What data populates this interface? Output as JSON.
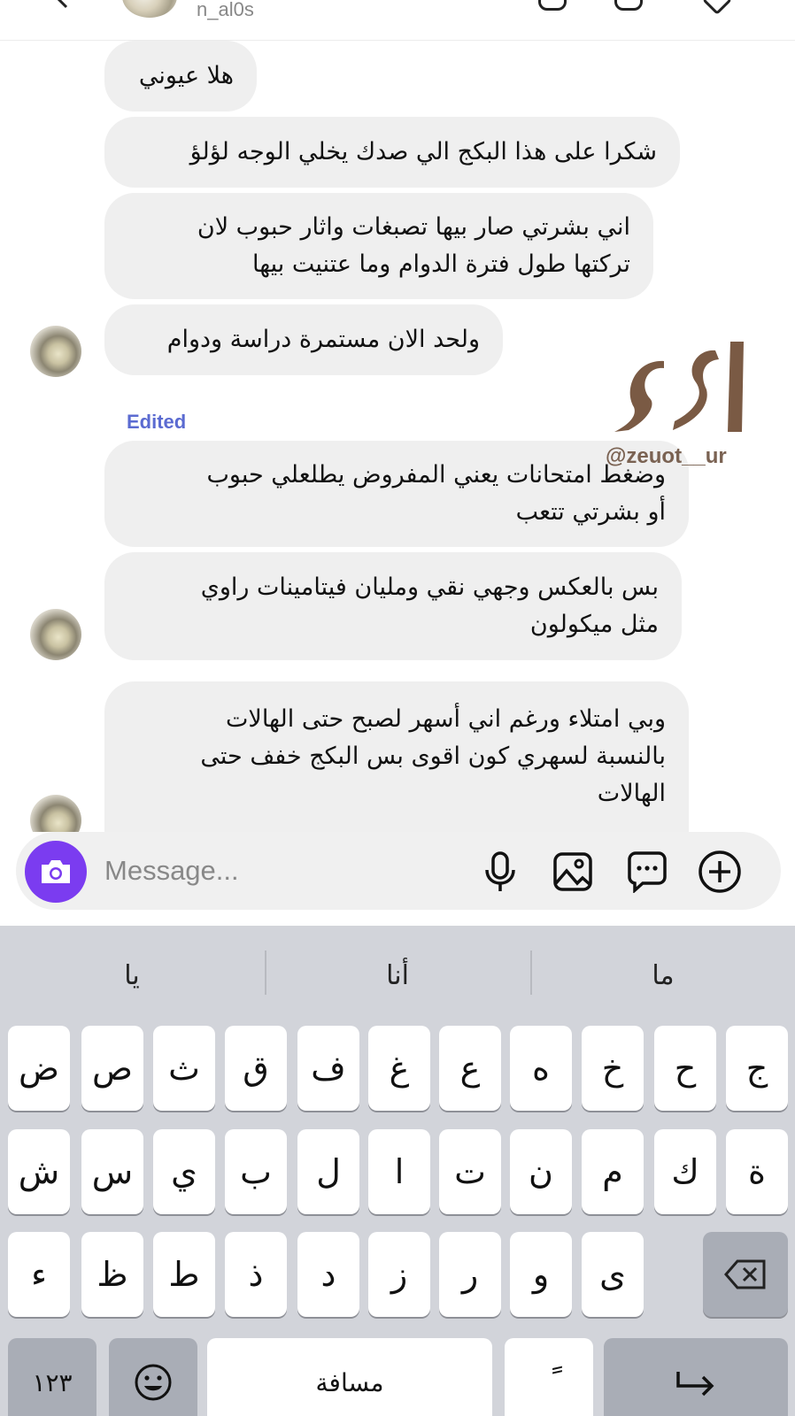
{
  "header": {
    "username": "n_al0s"
  },
  "messages": [
    {
      "lines": [
        "هلا عيوني"
      ]
    },
    {
      "lines": [
        "شكرا على هذا البكج الي صدك يخلي الوجه لؤلؤ"
      ]
    },
    {
      "lines": [
        "اني بشرتي صار بيها تصبغات واثار حبوب لان",
        "تركتها طول فترة الدوام وما عتنيت بيها"
      ]
    },
    {
      "lines": [
        "ولحد الان مستمرة دراسة ودوام"
      ]
    },
    {
      "lines": [
        "وضغط امتحانات يعني المفروض يطلعلي حبوب",
        "أو بشرتي تتعب"
      ]
    },
    {
      "lines": [
        "بس بالعكس وجهي نقي ومليان فيتامينات راوي",
        "مثل ميكولون"
      ]
    },
    {
      "lines": [
        "وبي امتلاء ورغم اني أسهر لصبح حتى الهالات",
        "بالنسبة لسهري كون اقوى بس البكج خفف حتى",
        "الهالات"
      ]
    }
  ],
  "edited_label": "Edited",
  "watermark": {
    "text": "@zeuot__ur"
  },
  "composer": {
    "placeholder": "Message...",
    "icons": [
      "camera-icon",
      "microphone-icon",
      "gallery-icon",
      "sticker-icon",
      "plus-icon"
    ],
    "camera_color": "#7b3cf0"
  },
  "keyboard": {
    "suggestions": [
      "يا",
      "أنا",
      "ما"
    ],
    "row1": [
      "ض",
      "ص",
      "ث",
      "ق",
      "ف",
      "غ",
      "ع",
      "ه",
      "خ",
      "ح",
      "ج"
    ],
    "row2": [
      "ش",
      "س",
      "ي",
      "ب",
      "ل",
      "ا",
      "ت",
      "ن",
      "م",
      "ك",
      "ة"
    ],
    "row3": [
      "ء",
      "ظ",
      "ط",
      "ذ",
      "د",
      "ز",
      "ر",
      "و",
      "ى"
    ],
    "numbers_label": "١٢٣",
    "space_label": "مسافة",
    "tanween_label": "ً"
  }
}
